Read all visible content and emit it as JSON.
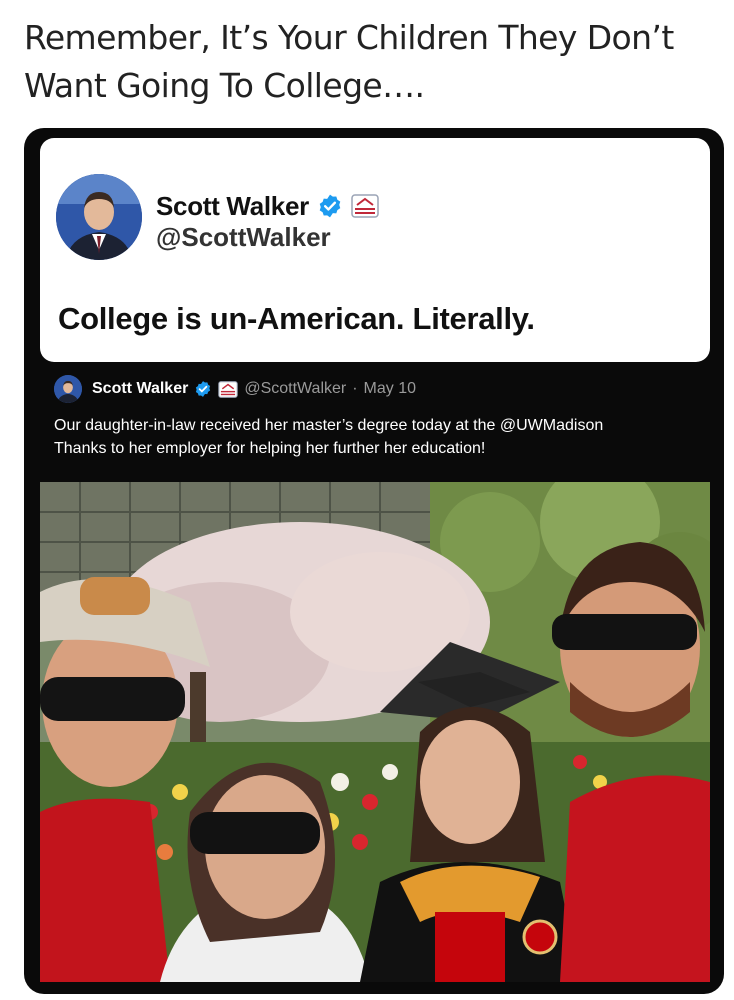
{
  "post": {
    "caption": "Remember, It’s Your Children They Don’t Want Going To College…."
  },
  "tweet": {
    "author_name": "Scott Walker",
    "author_handle": "@ScottWalker",
    "text": "College is un-American. Literally."
  },
  "quoted_tweet": {
    "author_name": "Scott Walker",
    "author_handle": "@ScottWalker",
    "separator": "·",
    "date": "May 10",
    "line1": "Our daughter-in-law received her master’s degree today at the @UWMadison",
    "line2": "Thanks to her employer for helping her further her education!"
  },
  "colors": {
    "verified_blue": "#1d9bf0",
    "frame_bg": "#0a0a0a",
    "badger_red": "#c5050c"
  },
  "icons": {
    "verified": "verified-badge-icon",
    "government": "government-badge-icon"
  }
}
